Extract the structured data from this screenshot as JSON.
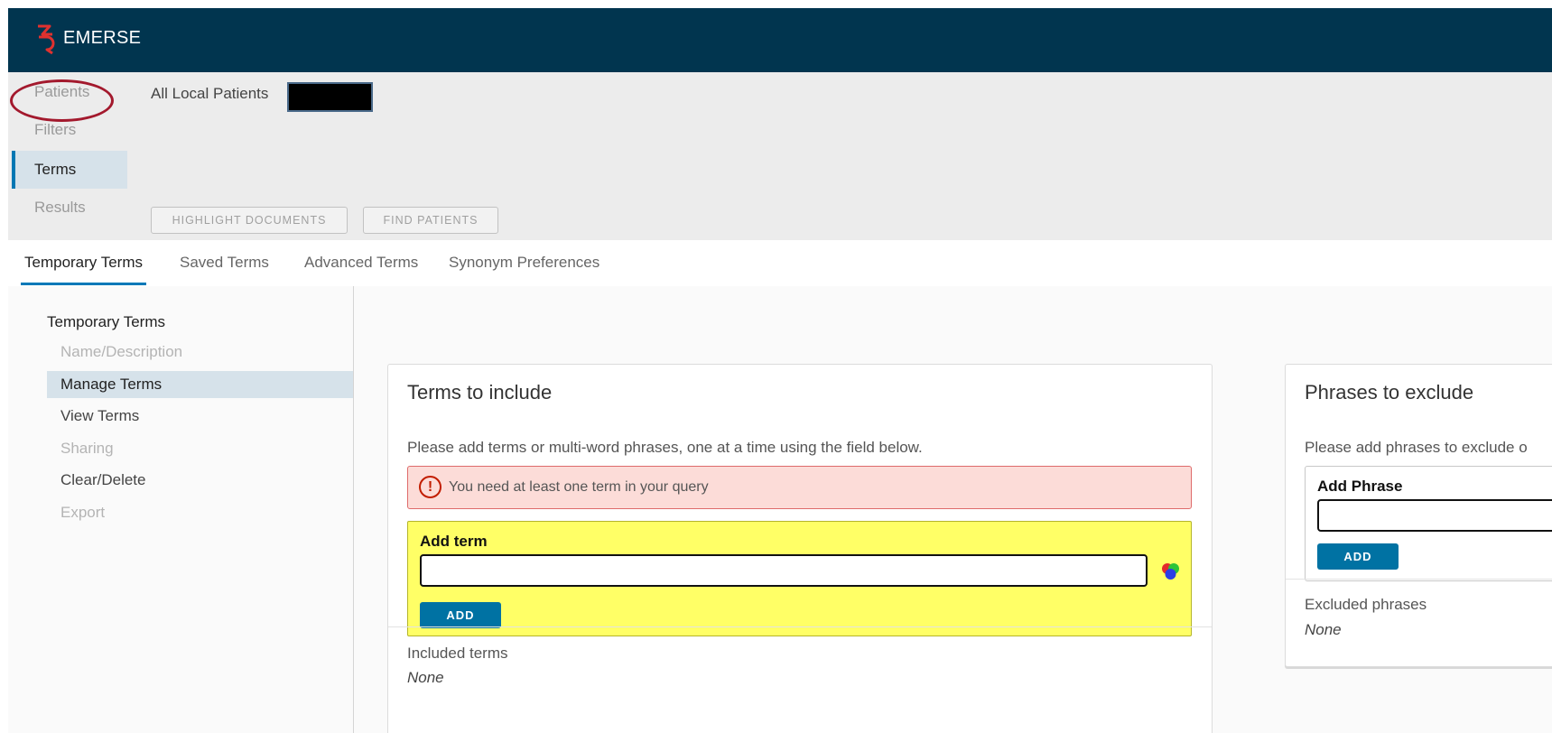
{
  "app": {
    "brand": "EMERSE",
    "accent": "#01354f",
    "highlight_color": "#ffff66"
  },
  "wizard": {
    "steps": [
      {
        "label": "Patients",
        "active": false,
        "circled": true
      },
      {
        "label": "Filters",
        "active": false
      },
      {
        "label": "Terms",
        "active": true
      },
      {
        "label": "Results",
        "active": false
      }
    ],
    "patient_set": "All Local Patients",
    "highlight_button": "HIGHLIGHT DOCUMENTS",
    "find_button": "FIND PATIENTS"
  },
  "tabs": [
    {
      "label": "Temporary Terms",
      "active": true
    },
    {
      "label": "Saved Terms"
    },
    {
      "label": "Advanced Terms"
    },
    {
      "label": "Synonym Preferences"
    }
  ],
  "leftnav": {
    "title": "Temporary Terms",
    "items": [
      {
        "label": "Name/Description",
        "disabled": true
      },
      {
        "label": "Manage Terms",
        "active": true
      },
      {
        "label": "View Terms"
      },
      {
        "label": "Sharing",
        "disabled": true
      },
      {
        "label": "Clear/Delete"
      },
      {
        "label": "Export",
        "disabled": true
      }
    ]
  },
  "include": {
    "title": "Terms to include",
    "description": "Please add terms or multi-word phrases, one at a time using the field below.",
    "alert": "You need at least one term in your query",
    "add_label": "Add term",
    "input_value": "",
    "add_button": "ADD",
    "included_label": "Included terms",
    "included_value": "None",
    "icons": {
      "alert": "exclamation-circle-icon",
      "synonyms": "color-circles-icon"
    }
  },
  "exclude": {
    "title": "Phrases to exclude",
    "description": "Please add phrases to exclude o",
    "add_label": "Add Phrase",
    "input_value": "",
    "add_button": "ADD",
    "excluded_label": "Excluded phrases",
    "excluded_value": "None"
  }
}
